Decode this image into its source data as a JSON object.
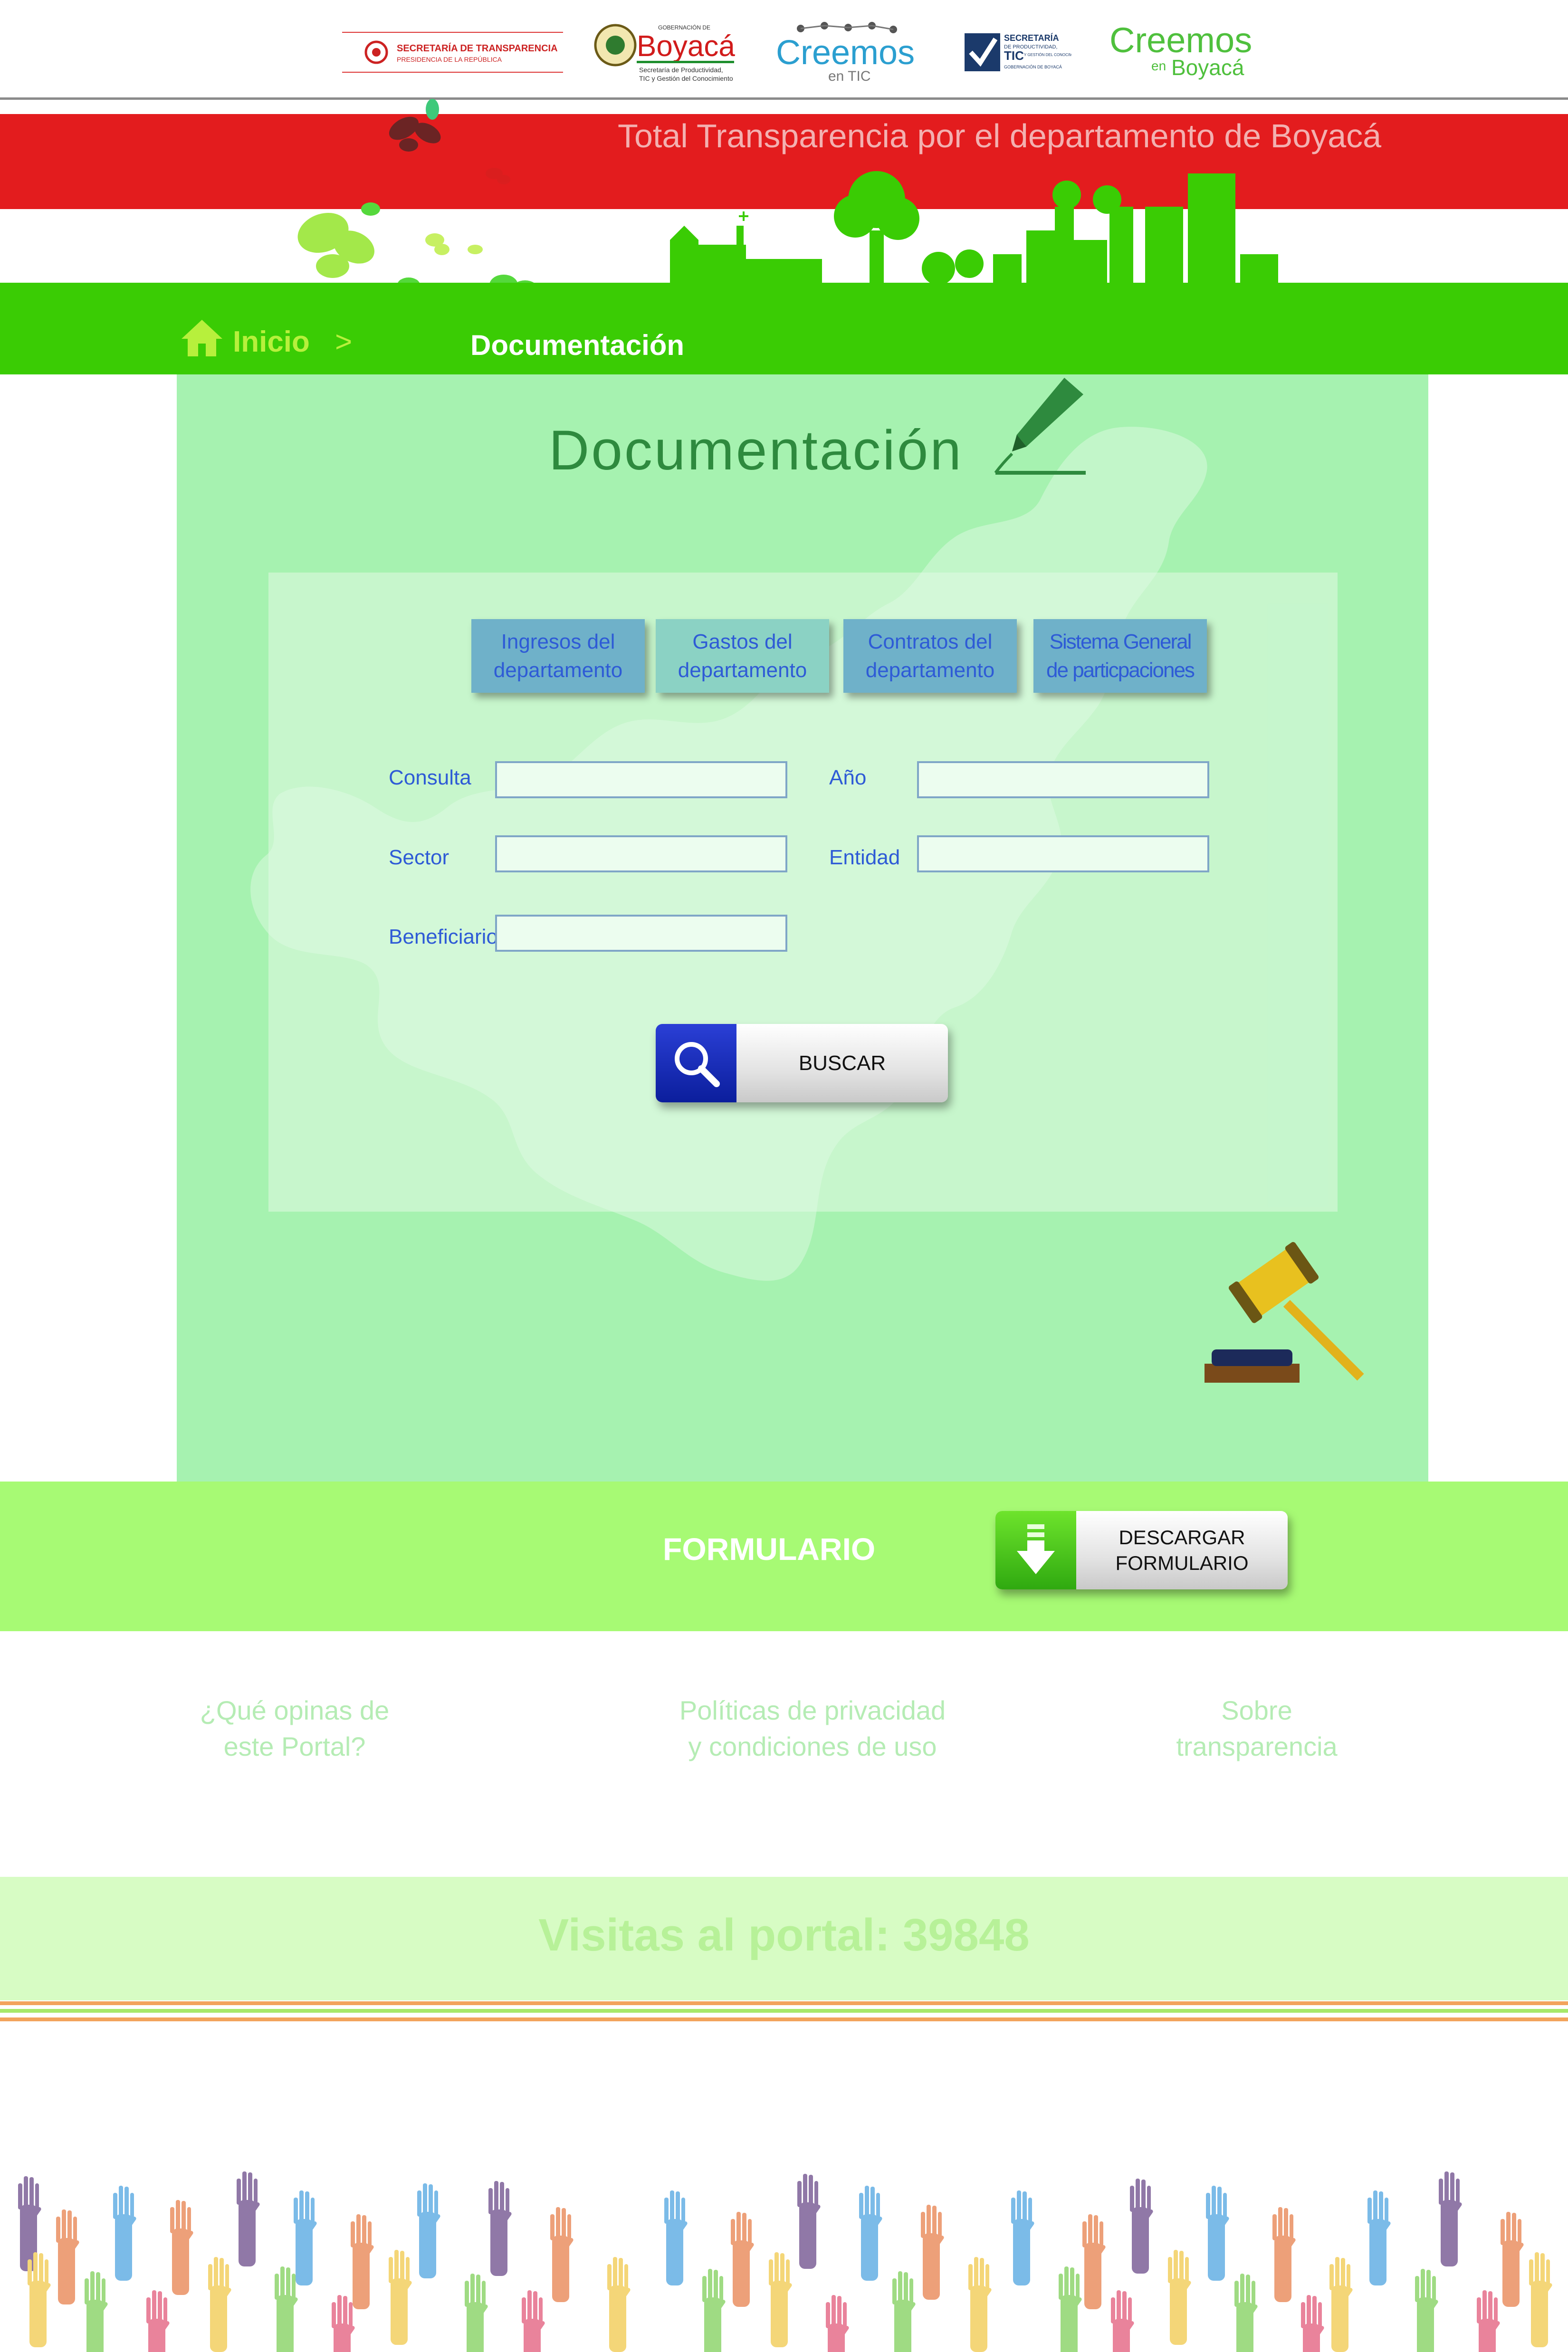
{
  "logos": {
    "transparencia": {
      "line1": "SECRETARÍA DE TRANSPARENCIA",
      "line2": "PRESIDENCIA DE LA REPÚBLICA"
    },
    "boyaca": {
      "small": "GOBERNACIÓN DE",
      "name": "Boyacá",
      "sub1": "Secretaría de Productividad,",
      "sub2": "TIC y Gestión del Conocimiento"
    },
    "creemos_tic": {
      "name": "Creemos",
      "sub": "en TIC"
    },
    "secretaria_tic": {
      "line1": "SECRETARÍA",
      "line2": "DE PRODUCTIVIDAD,",
      "line3": "TIC",
      "line4": "Y GESTIÓN DEL CONOCIMIENTO",
      "line5": "GOBERNACIÓN DE BOYACÁ"
    },
    "creemos_boyaca": {
      "name": "Creemos",
      "en": "en",
      "place": "Boyacá"
    }
  },
  "banner": {
    "tagline": "Total Transparencia por el departamento de Boyacá"
  },
  "breadcrumb": {
    "home": "Inicio",
    "separator": ">",
    "current": "Documentación"
  },
  "main": {
    "title": "Documentación",
    "tabs": [
      {
        "line1": "Ingresos del",
        "line2": "departamento"
      },
      {
        "line1": "Gastos del",
        "line2": "departamento"
      },
      {
        "line1": "Contratos del",
        "line2": "departamento"
      },
      {
        "line1": "Sistema General",
        "line2": "de particpaciones"
      }
    ],
    "fields": {
      "consulta": {
        "label": "Consulta",
        "value": ""
      },
      "anio": {
        "label": "Año",
        "value": ""
      },
      "sector": {
        "label": "Sector",
        "value": ""
      },
      "entidad": {
        "label": "Entidad",
        "value": ""
      },
      "beneficiario": {
        "label": "Beneficiario",
        "value": ""
      }
    },
    "search_button": "BUSCAR"
  },
  "formulario": {
    "label": "FORMULARIO",
    "download_line1": "DESCARGAR",
    "download_line2": "FORMULARIO"
  },
  "footer": {
    "links": [
      {
        "line1": "¿Qué opinas de",
        "line2": "este Portal?"
      },
      {
        "line1": "Políticas de privacidad",
        "line2": "y condiciones de uso"
      },
      {
        "line1": "Sobre",
        "line2": "transparencia"
      }
    ],
    "visits": "Visitas al portal: 39848"
  },
  "colors": {
    "red_band": "#e31c1e",
    "nav_green": "#3acc04",
    "panel_green": "#a6f2b0",
    "form_band": "#a7fa74",
    "label_blue": "#2e5bd6",
    "title_green": "#2e8a3e"
  },
  "icons": {
    "home": "home-icon",
    "pen": "fountain-pen-icon",
    "search": "magnifier-icon",
    "gavel": "gavel-icon",
    "download": "download-arrow-icon"
  }
}
